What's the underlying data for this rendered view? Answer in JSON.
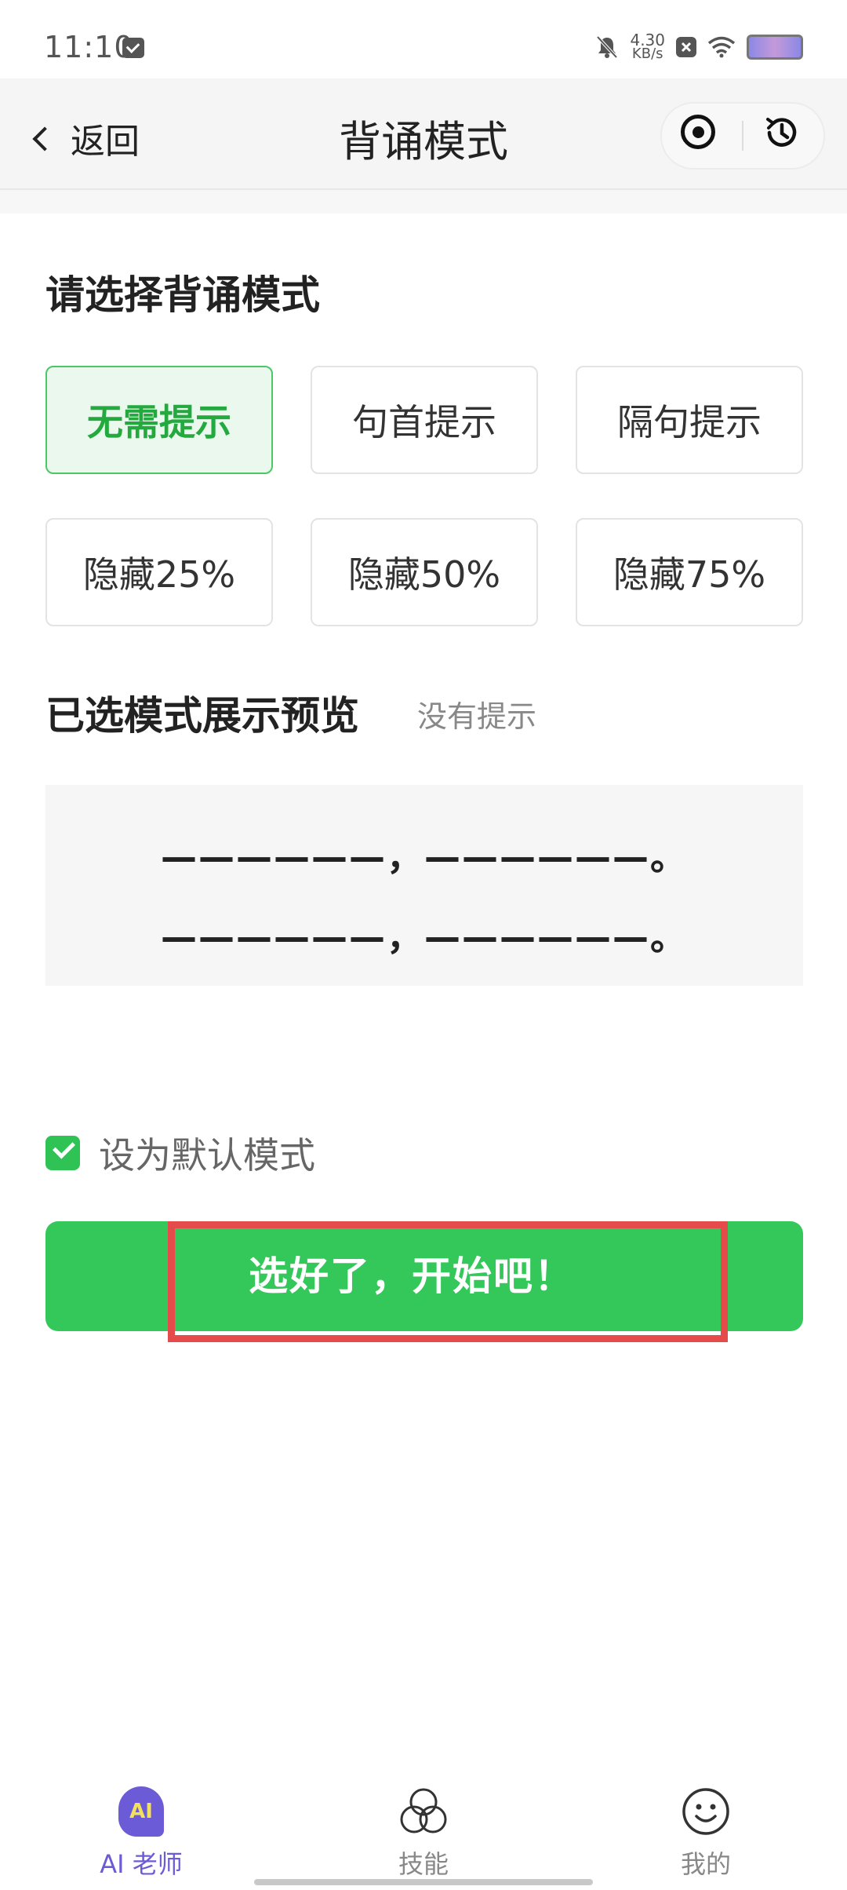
{
  "status_bar": {
    "time": "11:10",
    "net_speed_value": "4.30",
    "net_speed_unit": "KB/s",
    "icons": [
      "mail-icon",
      "mute-bell-icon",
      "data-off-icon",
      "wifi-icon",
      "battery-icon"
    ]
  },
  "header": {
    "back_label": "返回",
    "title": "背诵模式",
    "icons": [
      "target-icon",
      "history-icon"
    ]
  },
  "mode_section": {
    "title": "请选择背诵模式",
    "options": [
      {
        "label": "无需提示",
        "selected": true
      },
      {
        "label": "句首提示",
        "selected": false
      },
      {
        "label": "隔句提示",
        "selected": false
      },
      {
        "label": "隐藏25%",
        "selected": false
      },
      {
        "label": "隐藏50%",
        "selected": false
      },
      {
        "label": "隐藏75%",
        "selected": false
      }
    ]
  },
  "preview_section": {
    "title": "已选模式展示预览",
    "hint": "没有提示",
    "lines": [
      "——————，——————。",
      "——————，——————。"
    ]
  },
  "default_setting": {
    "label": "设为默认模式",
    "checked": true
  },
  "start_button": {
    "label": "选好了，开始吧！"
  },
  "tabbar": {
    "tabs": [
      {
        "label": "AI 老师",
        "icon": "ai-teacher-icon",
        "active": true,
        "icon_text": "AI"
      },
      {
        "label": "技能",
        "icon": "skills-icon",
        "active": false
      },
      {
        "label": "我的",
        "icon": "smiley-icon",
        "active": false
      }
    ]
  },
  "colors": {
    "accent_green": "#34c85a",
    "selected_text_green": "#24a93f",
    "tab_active_purple": "#6c5bd6",
    "highlight_red": "#e64b4b"
  }
}
